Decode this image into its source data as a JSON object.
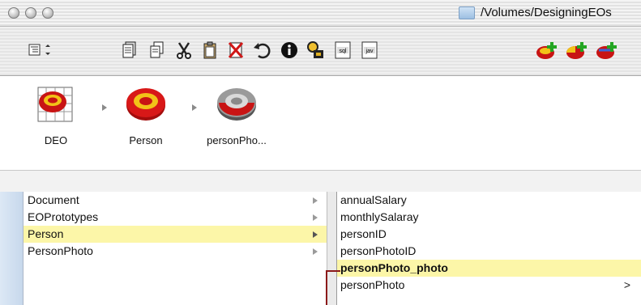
{
  "window": {
    "title": "/Volumes/DesigningEOs",
    "buttons": [
      "close",
      "minimize",
      "zoom"
    ]
  },
  "toolbar": {
    "view_menu_label": "",
    "icons": [
      "outline-view-icon",
      "new-model-icon",
      "copy-icon",
      "cut-icon",
      "paste-icon",
      "delete-icon",
      "undo-icon",
      "info-icon",
      "lock-icon",
      "sql-icon",
      "java-icon",
      "add-entity-icon",
      "add-attribute-icon",
      "add-relationship-icon"
    ]
  },
  "path": {
    "items": [
      {
        "label": "DEO"
      },
      {
        "label": "Person"
      },
      {
        "label": "personPho..."
      }
    ]
  },
  "browser": {
    "column1": [
      {
        "label": "Document",
        "selected": false
      },
      {
        "label": "EOPrototypes",
        "selected": false
      },
      {
        "label": "Person",
        "selected": true
      },
      {
        "label": "PersonPhoto",
        "selected": false
      }
    ],
    "column2": [
      {
        "label": "annualSalary"
      },
      {
        "label": "monthlySalaray"
      },
      {
        "label": "personID"
      },
      {
        "label": "personPhotoID"
      },
      {
        "label": "personPhoto_photo",
        "selected": true
      },
      {
        "label": "personPhoto",
        "suffix": ">"
      }
    ]
  },
  "colors": {
    "selection": "#fcf6a8",
    "relationship_bracket": "#8b1a1a"
  }
}
